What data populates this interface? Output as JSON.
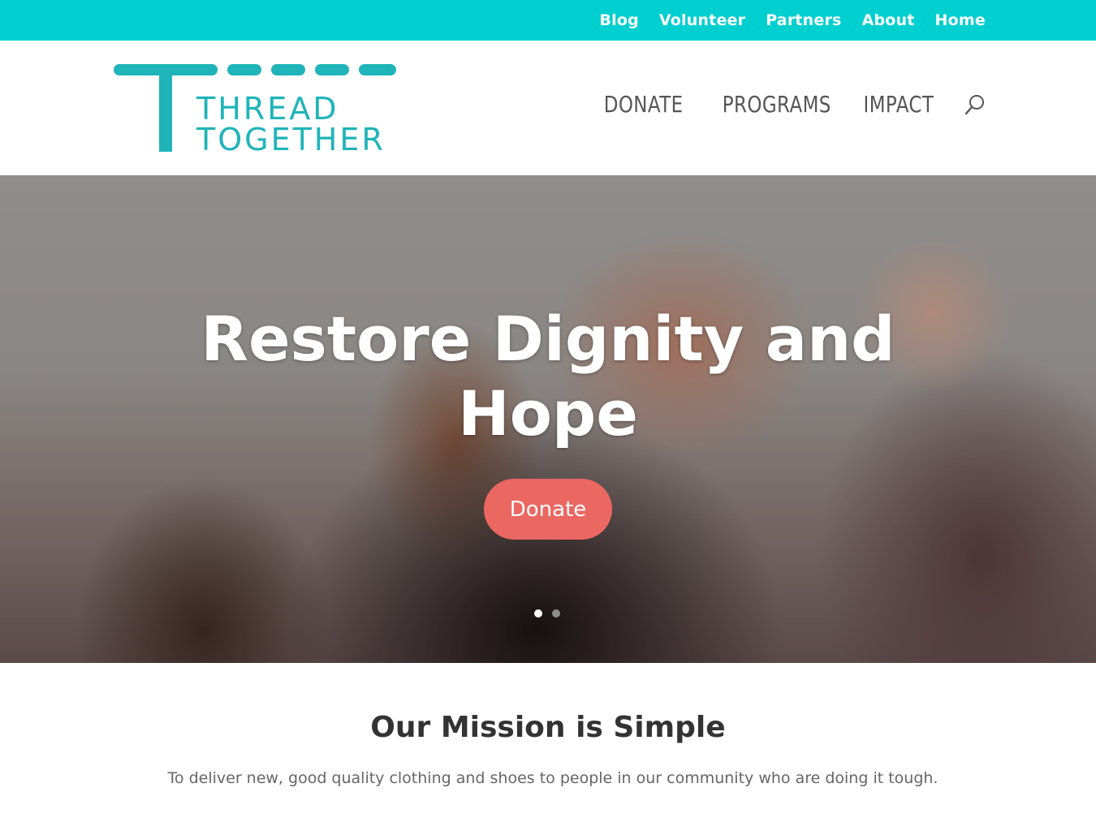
{
  "topbar": {
    "color": "#00cfcf",
    "links": [
      "Blog",
      "Volunteer",
      "Partners",
      "About",
      "Home"
    ]
  },
  "header": {
    "logo": {
      "line1": "THREAD",
      "line2": "TOGETHER",
      "color": "#1fb4b9"
    },
    "nav": [
      "DONATE",
      "PROGRAMS",
      "IMPACT"
    ],
    "search_icon": "search-icon"
  },
  "hero": {
    "title_line1": "Restore Dignity and",
    "title_line2": "Hope",
    "button_label": "Donate",
    "button_color": "#eb6762",
    "slides_total": 2,
    "active_slide": 1
  },
  "mission": {
    "title": "Our Mission is Simple",
    "text": "To deliver new, good quality clothing and shoes to people in our community who are doing it tough."
  }
}
